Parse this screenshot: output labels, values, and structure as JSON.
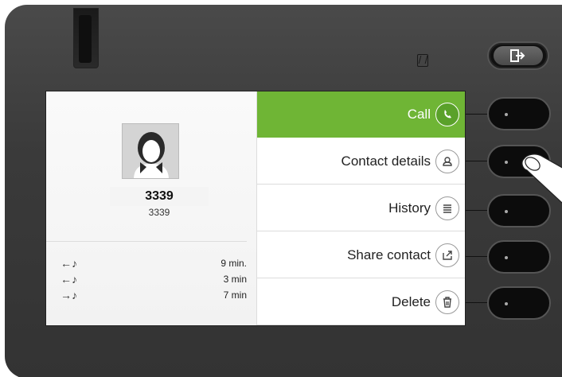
{
  "contact": {
    "name": "3339",
    "number": "3339",
    "avatar_icon": "person-silhouette-icon"
  },
  "history": [
    {
      "direction": "incoming",
      "direction_icon": "incoming-call-icon",
      "duration": "9 min."
    },
    {
      "direction": "incoming",
      "direction_icon": "incoming-call-icon",
      "duration": "3 min"
    },
    {
      "direction": "outgoing",
      "direction_icon": "outgoing-call-icon",
      "duration": "7 min"
    }
  ],
  "menu": [
    {
      "label": "Call",
      "icon": "phone-icon",
      "active": true
    },
    {
      "label": "Contact details",
      "icon": "contact-icon",
      "active": false
    },
    {
      "label": "History",
      "icon": "list-icon",
      "active": false
    },
    {
      "label": "Share contact",
      "icon": "share-icon",
      "active": false
    },
    {
      "label": "Delete",
      "icon": "trash-icon",
      "active": false
    }
  ],
  "colors": {
    "accent": "#6fb535",
    "device_body": "#3a3a3a",
    "screen_bg": "#ffffff"
  }
}
